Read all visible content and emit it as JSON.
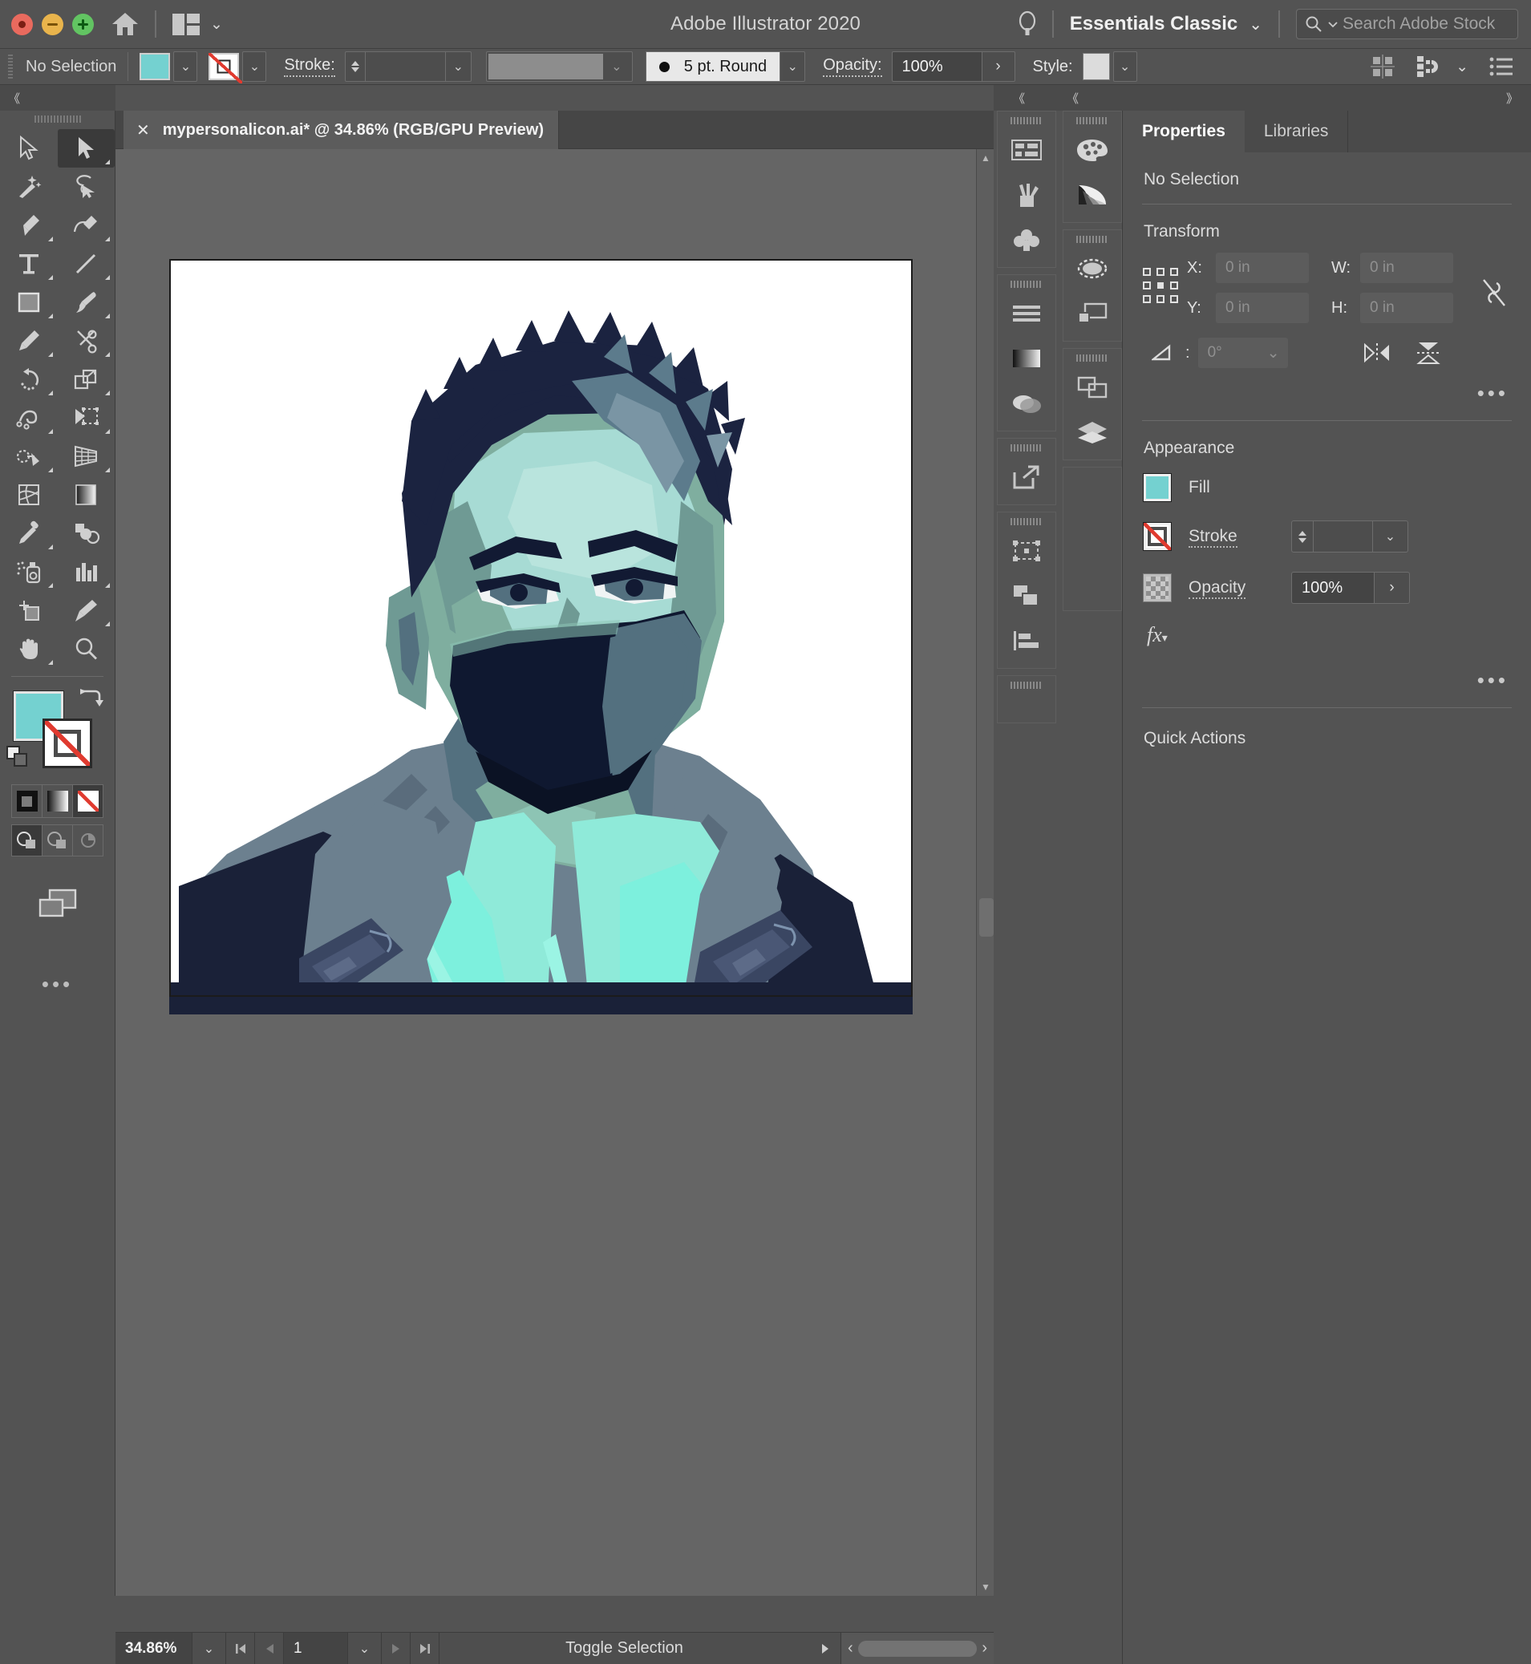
{
  "window": {
    "app_title": "Adobe Illustrator 2020",
    "traffic_lights": [
      "close-button",
      "minimize-button",
      "maximize-button"
    ],
    "home_icon": "home-icon",
    "arrange_icon": "arrange-documents-icon",
    "arrange_chevron": "⌄",
    "search_hint_icon": "lightbulb-icon",
    "workspace": "Essentials Classic",
    "workspace_chevron": "⌄",
    "search_placeholder": "Search Adobe Stock",
    "search_icon": "search-icon"
  },
  "control_bar": {
    "selection_status": "No Selection",
    "fill_swatch_color": "#74d1d0",
    "stroke_swatch": "none",
    "stroke_label": "Stroke:",
    "stroke_weight_value": "",
    "brush_label": "5 pt. Round",
    "opacity_label": "Opacity:",
    "opacity_value": "100%",
    "style_label": "Style:",
    "style_swatch_color": "#dcdcdc",
    "right_icons": [
      "align-icon",
      "snap-to-glyph-icon",
      "chevron-down-icon",
      "document-setup-icon"
    ]
  },
  "tabs": {
    "close_glyph": "✕",
    "document_title": "mypersonalicon.ai* @ 34.86% (RGB/GPU Preview)"
  },
  "toolbar": {
    "collapse_glyph": "《",
    "tools": [
      {
        "name": "selection-tool",
        "selected": false
      },
      {
        "name": "direct-selection-tool",
        "selected": true
      },
      {
        "name": "magic-wand-tool",
        "selected": false
      },
      {
        "name": "lasso-tool",
        "selected": false
      },
      {
        "name": "pen-tool",
        "selected": false
      },
      {
        "name": "curvature-tool",
        "selected": false
      },
      {
        "name": "type-tool",
        "selected": false
      },
      {
        "name": "line-segment-tool",
        "selected": false
      },
      {
        "name": "rectangle-tool",
        "selected": false
      },
      {
        "name": "paintbrush-tool",
        "selected": false
      },
      {
        "name": "pencil-tool",
        "selected": false
      },
      {
        "name": "scissors-tool",
        "selected": false
      },
      {
        "name": "rotate-tool",
        "selected": false
      },
      {
        "name": "scale-tool",
        "selected": false
      },
      {
        "name": "width-tool",
        "selected": false
      },
      {
        "name": "free-transform-tool",
        "selected": false
      },
      {
        "name": "shape-builder-tool",
        "selected": false
      },
      {
        "name": "perspective-grid-tool",
        "selected": false
      },
      {
        "name": "mesh-tool",
        "selected": false
      },
      {
        "name": "gradient-tool",
        "selected": false
      },
      {
        "name": "eyedropper-tool",
        "selected": false
      },
      {
        "name": "blend-tool",
        "selected": false
      },
      {
        "name": "symbol-sprayer-tool",
        "selected": false
      },
      {
        "name": "column-graph-tool",
        "selected": false
      },
      {
        "name": "artboard-tool",
        "selected": false
      },
      {
        "name": "slice-tool",
        "selected": false
      },
      {
        "name": "hand-tool",
        "selected": false
      },
      {
        "name": "zoom-tool",
        "selected": false
      }
    ],
    "fill_color": "#74d1d0",
    "stroke_color": "none",
    "swap_icon": "swap-fill-stroke-icon",
    "default_icon": "default-fill-stroke-icon",
    "color_modes": [
      "color-mode-solid",
      "color-mode-gradient",
      "color-mode-none"
    ],
    "color_mode_active": "color-mode-none",
    "draw_modes": [
      "draw-normal",
      "draw-behind",
      "draw-inside"
    ],
    "draw_mode_active": "draw-normal",
    "screen_mode_icon": "screen-mode-icon",
    "more_glyph": "•••"
  },
  "panel_rails": {
    "left_rail_collapse": "《",
    "right_rail_collapse": "《",
    "dock_expand": "》",
    "left_rail_groups": [
      {
        "icons": [
          "artboards-panel-icon",
          "brushes-panel-icon",
          "symbols-panel-icon"
        ]
      },
      {
        "icons": [
          "align-panel-icon",
          "gradient-panel-icon",
          "transparency-panel-icon"
        ]
      },
      {
        "icons": [
          "export-panel-icon"
        ]
      },
      {
        "icons": [
          "artboard-tool-panel-icon",
          "layers-compact-icon",
          "align-objects-icon"
        ]
      }
    ],
    "right_rail_groups": [
      {
        "icons": [
          "color-panel-icon",
          "color-guide-panel-icon"
        ]
      },
      {
        "icons": [
          "appearance-panel-icon",
          "pathfinder-panel-icon"
        ]
      },
      {
        "icons": [
          "artboards-list-icon",
          "layers-panel-icon"
        ]
      }
    ]
  },
  "properties": {
    "tab_active": "Properties",
    "tab_inactive": "Libraries",
    "selection_state": "No Selection",
    "transform": {
      "title": "Transform",
      "reference_point_icon": "reference-point-icon",
      "x_label": "X:",
      "x_value": "0 in",
      "y_label": "Y:",
      "y_value": "0 in",
      "w_label": "W:",
      "w_value": "0 in",
      "h_label": "H:",
      "h_value": "0 in",
      "link_icon": "unlink-proportions-icon",
      "angle_label": "angle-icon",
      "angle_value": "0°",
      "angle_chevron": "⌄",
      "flip_horizontal_icon": "flip-horizontal-icon",
      "flip_vertical_icon": "flip-vertical-icon",
      "more_glyph": "•••"
    },
    "appearance": {
      "title": "Appearance",
      "fill_label": "Fill",
      "fill_color": "#74d1d0",
      "stroke_label": "Stroke",
      "stroke_color": "none",
      "stroke_weight": "",
      "opacity_label": "Opacity",
      "opacity_value": "100%",
      "fx_label": "fx",
      "more_glyph": "•••"
    },
    "quick_actions": {
      "title": "Quick Actions"
    }
  },
  "status_bar": {
    "zoom_value": "34.86%",
    "zoom_chevron": "⌄",
    "first_page_icon": "first-page-icon",
    "prev_page_icon": "prev-page-icon",
    "page_value": "1",
    "page_chevron": "⌄",
    "next_page_icon": "next-page-icon",
    "last_page_icon": "last-page-icon",
    "status_text": "Toggle Selection",
    "status_menu_icon": "status-menu-icon",
    "scroll_left_icon": "‹",
    "scroll_right_icon": "›"
  },
  "artwork": {
    "description": "vector-portrait-masked-person",
    "palette": {
      "background": "#ffffff",
      "hair_dark": "#1b2340",
      "hair_mid": "#5c7b8c",
      "hair_light": "#7a95a4",
      "skin_mid": "#7fae9f",
      "skin_light": "#a7dbd4",
      "skin_highlight": "#b9e4dd",
      "skin_shadow": "#6f9a94",
      "mask_dark": "#0f1830",
      "mask_mid": "#53707f",
      "hoodie_gray": "#6c808f",
      "hoodie_dark": "#2b3450",
      "jacket_dark": "#1a2138",
      "scarf_teal": "#8fead9",
      "scarf_bright": "#7df0dd"
    }
  }
}
